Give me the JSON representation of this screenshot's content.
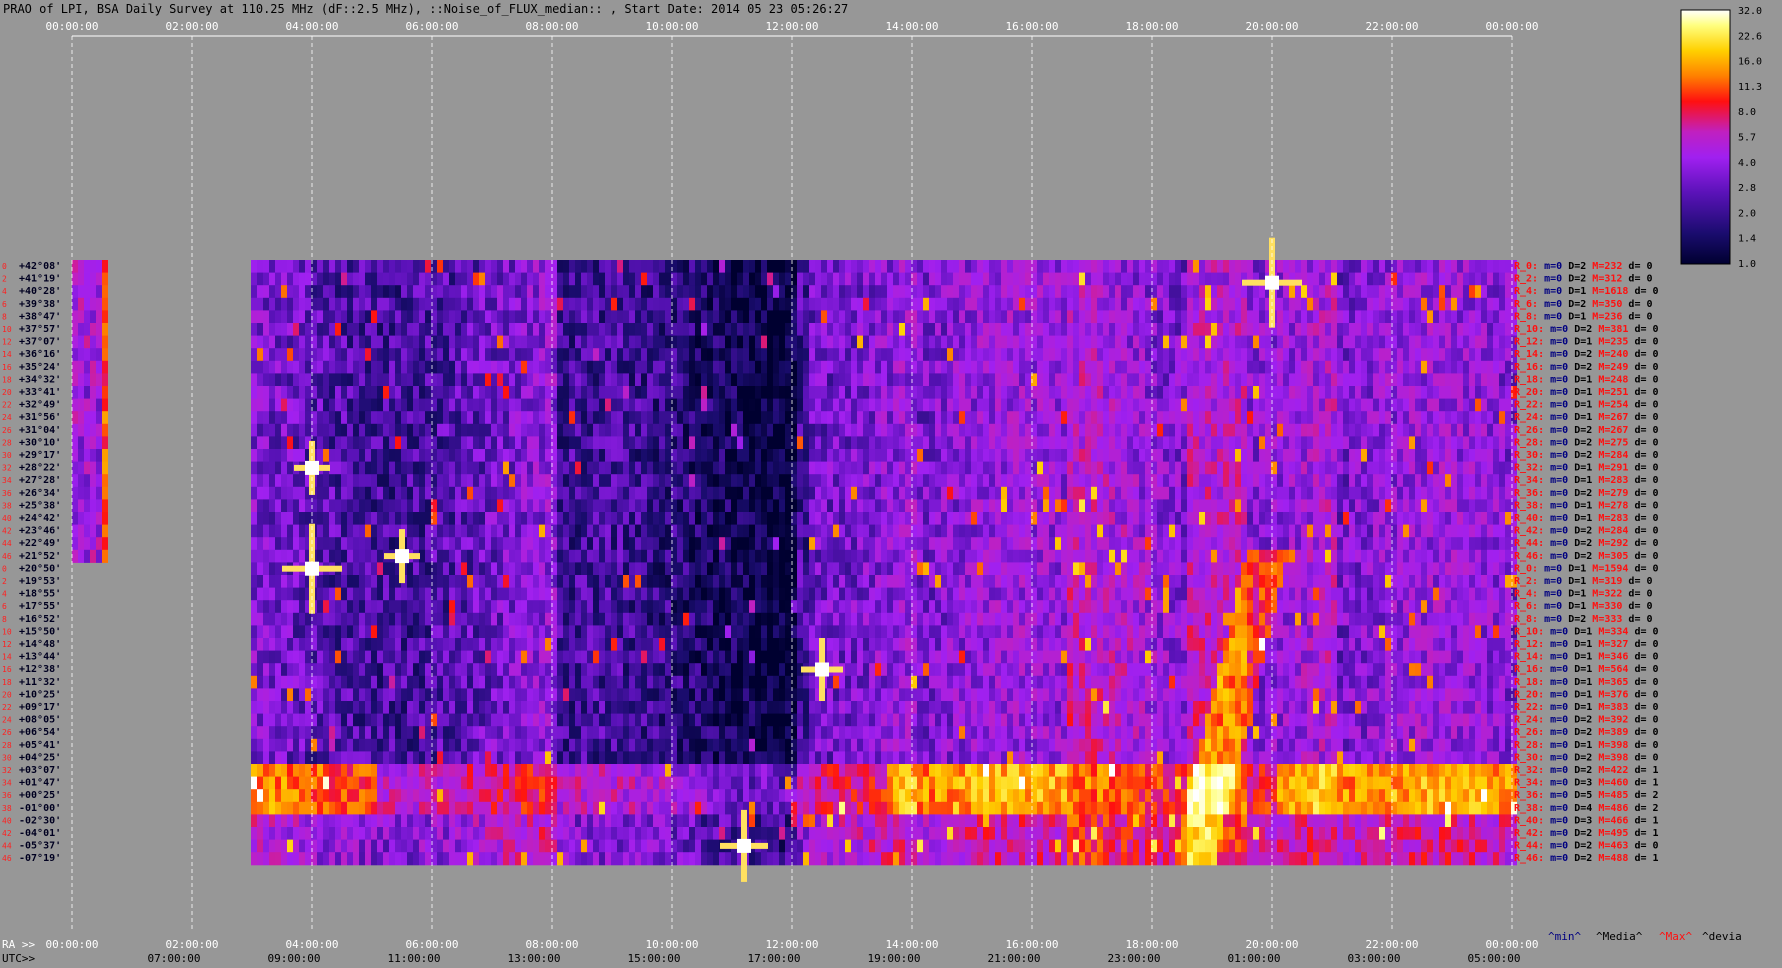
{
  "title": "PRAO of LPI, BSA Daily Survey at 110.25 MHz (dF::2.5 MHz), ::Noise_of_FLUX_median:: , Start Date: 2014 05 23 05:26:27",
  "colors": {
    "background": "#979797",
    "colormap": [
      "#000030",
      "#1a0c6e",
      "#5a12b8",
      "#a020f0",
      "#c020c0",
      "#ff1010",
      "#ff8000",
      "#ffd000",
      "#ffff80",
      "#ffffff"
    ]
  },
  "axes": {
    "top_ticks": [
      "00:00:00",
      "02:00:00",
      "04:00:00",
      "06:00:00",
      "08:00:00",
      "10:00:00",
      "12:00:00",
      "14:00:00",
      "16:00:00",
      "18:00:00",
      "20:00:00",
      "22:00:00",
      "00:00:00"
    ],
    "ra_prefix": "RA >>",
    "ra_ticks": [
      "00:00:00",
      "02:00:00",
      "04:00:00",
      "06:00:00",
      "08:00:00",
      "10:00:00",
      "12:00:00",
      "14:00:00",
      "16:00:00",
      "18:00:00",
      "20:00:00",
      "22:00:00",
      "00:00:00"
    ],
    "utc_prefix": "UTC>>",
    "utc_ticks": [
      "07:00:00",
      "09:00:00",
      "11:00:00",
      "13:00:00",
      "15:00:00",
      "17:00:00",
      "19:00:00",
      "21:00:00",
      "23:00:00",
      "01:00:00",
      "03:00:00",
      "05:00:00"
    ]
  },
  "colorbar": {
    "ticks": [
      "32.0",
      "22.6",
      "16.0",
      "11.3",
      "8.0",
      "5.7",
      "4.0",
      "2.8",
      "2.0",
      "1.4",
      "1.0"
    ]
  },
  "declinations": [
    "+42°08'",
    "+41°19'",
    "+40°28'",
    "+39°38'",
    "+38°47'",
    "+37°57'",
    "+37°07'",
    "+36°16'",
    "+35°24'",
    "+34°32'",
    "+33°41'",
    "+32°49'",
    "+31°56'",
    "+31°04'",
    "+30°10'",
    "+29°17'",
    "+28°22'",
    "+27°28'",
    "+26°34'",
    "+25°38'",
    "+24°42'",
    "+23°46'",
    "+22°49'",
    "+21°52'",
    "+20°50'",
    "+19°53'",
    "+18°55'",
    "+17°55'",
    "+16°52'",
    "+15°50'",
    "+14°48'",
    "+13°44'",
    "+12°38'",
    "+11°32'",
    "+10°25'",
    "+09°17'",
    "+08°05'",
    "+06°54'",
    "+05°41'",
    "+04°25'",
    "+03°07'",
    "+01°47'",
    "+00°25'",
    "-01°00'",
    "-02°30'",
    "-04°01'",
    "-05°37'",
    "-07°19'"
  ],
  "dec_indices": [
    "0",
    "2",
    "4",
    "6",
    "8",
    "10",
    "12",
    "14",
    "16",
    "18",
    "20",
    "22",
    "24",
    "26",
    "28",
    "30",
    "32",
    "34",
    "36",
    "38",
    "40",
    "42",
    "44",
    "46",
    "0",
    "2",
    "4",
    "6",
    "8",
    "10",
    "12",
    "14",
    "16",
    "18",
    "20",
    "22",
    "24",
    "26",
    "28",
    "30",
    "32",
    "34",
    "36",
    "38",
    "40",
    "42",
    "44",
    "46"
  ],
  "rows": [
    {
      "r": "R_0:",
      "m": "m=0",
      "D": "D=2",
      "M": "M=232",
      "d": "d= 0"
    },
    {
      "r": "R_2:",
      "m": "m=0",
      "D": "D=2",
      "M": "M=312",
      "d": "d= 0"
    },
    {
      "r": "R_4:",
      "m": "m=0",
      "D": "D=1",
      "M": "M=1618",
      "d": "d= 0"
    },
    {
      "r": "R_6:",
      "m": "m=0",
      "D": "D=2",
      "M": "M=350",
      "d": "d= 0"
    },
    {
      "r": "R_8:",
      "m": "m=0",
      "D": "D=1",
      "M": "M=236",
      "d": "d= 0"
    },
    {
      "r": "R_10:",
      "m": "m=0",
      "D": "D=2",
      "M": "M=381",
      "d": "d= 0"
    },
    {
      "r": "R_12:",
      "m": "m=0",
      "D": "D=1",
      "M": "M=235",
      "d": "d= 0"
    },
    {
      "r": "R_14:",
      "m": "m=0",
      "D": "D=2",
      "M": "M=240",
      "d": "d= 0"
    },
    {
      "r": "R_16:",
      "m": "m=0",
      "D": "D=2",
      "M": "M=249",
      "d": "d= 0"
    },
    {
      "r": "R_18:",
      "m": "m=0",
      "D": "D=1",
      "M": "M=248",
      "d": "d= 0"
    },
    {
      "r": "R_20:",
      "m": "m=0",
      "D": "D=1",
      "M": "M=251",
      "d": "d= 0"
    },
    {
      "r": "R_22:",
      "m": "m=0",
      "D": "D=1",
      "M": "M=254",
      "d": "d= 0"
    },
    {
      "r": "R_24:",
      "m": "m=0",
      "D": "D=1",
      "M": "M=267",
      "d": "d= 0"
    },
    {
      "r": "R_26:",
      "m": "m=0",
      "D": "D=2",
      "M": "M=267",
      "d": "d= 0"
    },
    {
      "r": "R_28:",
      "m": "m=0",
      "D": "D=2",
      "M": "M=275",
      "d": "d= 0"
    },
    {
      "r": "R_30:",
      "m": "m=0",
      "D": "D=2",
      "M": "M=284",
      "d": "d= 0"
    },
    {
      "r": "R_32:",
      "m": "m=0",
      "D": "D=1",
      "M": "M=291",
      "d": "d= 0"
    },
    {
      "r": "R_34:",
      "m": "m=0",
      "D": "D=1",
      "M": "M=283",
      "d": "d= 0"
    },
    {
      "r": "R_36:",
      "m": "m=0",
      "D": "D=2",
      "M": "M=279",
      "d": "d= 0"
    },
    {
      "r": "R_38:",
      "m": "m=0",
      "D": "D=1",
      "M": "M=278",
      "d": "d= 0"
    },
    {
      "r": "R_40:",
      "m": "m=0",
      "D": "D=1",
      "M": "M=283",
      "d": "d= 0"
    },
    {
      "r": "R_42:",
      "m": "m=0",
      "D": "D=2",
      "M": "M=284",
      "d": "d= 0"
    },
    {
      "r": "R_44:",
      "m": "m=0",
      "D": "D=2",
      "M": "M=292",
      "d": "d= 0"
    },
    {
      "r": "R_46:",
      "m": "m=0",
      "D": "D=2",
      "M": "M=305",
      "d": "d= 0"
    },
    {
      "r": "R_0:",
      "m": "m=0",
      "D": "D=1",
      "M": "M=1594",
      "d": "d= 0"
    },
    {
      "r": "R_2:",
      "m": "m=0",
      "D": "D=1",
      "M": "M=319",
      "d": "d= 0"
    },
    {
      "r": "R_4:",
      "m": "m=0",
      "D": "D=1",
      "M": "M=322",
      "d": "d= 0"
    },
    {
      "r": "R_6:",
      "m": "m=0",
      "D": "D=1",
      "M": "M=330",
      "d": "d= 0"
    },
    {
      "r": "R_8:",
      "m": "m=0",
      "D": "D=2",
      "M": "M=333",
      "d": "d= 0"
    },
    {
      "r": "R_10:",
      "m": "m=0",
      "D": "D=1",
      "M": "M=334",
      "d": "d= 0"
    },
    {
      "r": "R_12:",
      "m": "m=0",
      "D": "D=1",
      "M": "M=327",
      "d": "d= 0"
    },
    {
      "r": "R_14:",
      "m": "m=0",
      "D": "D=1",
      "M": "M=346",
      "d": "d= 0"
    },
    {
      "r": "R_16:",
      "m": "m=0",
      "D": "D=1",
      "M": "M=564",
      "d": "d= 0"
    },
    {
      "r": "R_18:",
      "m": "m=0",
      "D": "D=1",
      "M": "M=365",
      "d": "d= 0"
    },
    {
      "r": "R_20:",
      "m": "m=0",
      "D": "D=1",
      "M": "M=376",
      "d": "d= 0"
    },
    {
      "r": "R_22:",
      "m": "m=0",
      "D": "D=1",
      "M": "M=383",
      "d": "d= 0"
    },
    {
      "r": "R_24:",
      "m": "m=0",
      "D": "D=2",
      "M": "M=392",
      "d": "d= 0"
    },
    {
      "r": "R_26:",
      "m": "m=0",
      "D": "D=2",
      "M": "M=389",
      "d": "d= 0"
    },
    {
      "r": "R_28:",
      "m": "m=0",
      "D": "D=1",
      "M": "M=398",
      "d": "d= 0"
    },
    {
      "r": "R_30:",
      "m": "m=0",
      "D": "D=2",
      "M": "M=398",
      "d": "d= 0"
    },
    {
      "r": "R_32:",
      "m": "m=0",
      "D": "D=2",
      "M": "M=422",
      "d": "d= 1"
    },
    {
      "r": "R_34:",
      "m": "m=0",
      "D": "D=3",
      "M": "M=460",
      "d": "d= 1"
    },
    {
      "r": "R_36:",
      "m": "m=0",
      "D": "D=5",
      "M": "M=485",
      "d": "d= 2"
    },
    {
      "r": "R_38:",
      "m": "m=0",
      "D": "D=4",
      "M": "M=486",
      "d": "d= 2"
    },
    {
      "r": "R_40:",
      "m": "m=0",
      "D": "D=3",
      "M": "M=466",
      "d": "d= 1"
    },
    {
      "r": "R_42:",
      "m": "m=0",
      "D": "D=2",
      "M": "M=495",
      "d": "d= 1"
    },
    {
      "r": "R_44:",
      "m": "m=0",
      "D": "D=2",
      "M": "M=463",
      "d": "d= 0"
    },
    {
      "r": "R_46:",
      "m": "m=0",
      "D": "D=2",
      "M": "M=488",
      "d": "d= 1"
    }
  ],
  "legend": {
    "min": "^min^",
    "media": "^Media^",
    "max": "^Max^",
    "devia": "^devia"
  },
  "chart_data": {
    "type": "heatmap",
    "title": "PRAO of LPI, BSA Daily Survey at 110.25 MHz (dF::2.5 MHz), ::Noise_of_FLUX_median:: , Start Date: 2014 05 23 05:26:27",
    "x_axis_ra": [
      "00:00:00",
      "02:00:00",
      "04:00:00",
      "06:00:00",
      "08:00:00",
      "10:00:00",
      "12:00:00",
      "14:00:00",
      "16:00:00",
      "18:00:00",
      "20:00:00",
      "22:00:00",
      "00:00:00"
    ],
    "x_axis_utc": [
      "07:00:00",
      "09:00:00",
      "11:00:00",
      "13:00:00",
      "15:00:00",
      "17:00:00",
      "19:00:00",
      "21:00:00",
      "23:00:00",
      "01:00:00",
      "03:00:00",
      "05:00:00"
    ],
    "y_axis_declination_range": [
      "+42°08'",
      "-07°19'"
    ],
    "colorbar_range": [
      1.0,
      32.0
    ],
    "colorbar_scale": "log",
    "bright_sources_ra_hours": [
      4.0,
      4.0,
      5.5,
      12.5,
      19.1,
      20.0
    ]
  }
}
